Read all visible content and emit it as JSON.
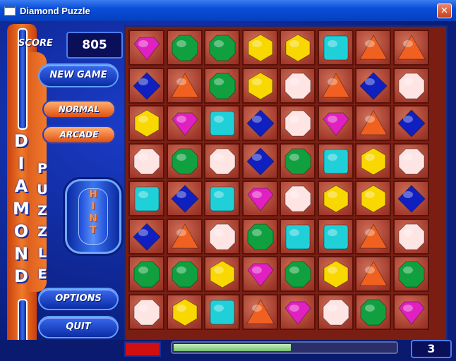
{
  "window": {
    "title": "Diamond Puzzle",
    "close_glyph": "✕"
  },
  "side": {
    "score_label": "SCORE",
    "score_value": "805",
    "new_game_label": "NEW GAME",
    "normal_label": "NORMAL",
    "arcade_label": "ARCADE",
    "hint_letters": [
      "H",
      "I",
      "N",
      "T"
    ],
    "options_label": "OPTIONS",
    "quit_label": "QUIT",
    "title_word1": [
      "D",
      "I",
      "A",
      "M",
      "O",
      "N",
      "D"
    ],
    "title_word2": [
      "P",
      "U",
      "Z",
      "Z",
      "L",
      "E"
    ]
  },
  "status": {
    "level": "3",
    "progress": 0.53,
    "indicator_color": "#d01010"
  },
  "colors": {
    "magenta": "#e020c0",
    "green": "#10a040",
    "yellow": "#f8d800",
    "cyan": "#20d0d8",
    "orange": "#f06020",
    "blue": "#1020c0",
    "white": "#ffe4e4"
  },
  "board": [
    [
      "magenta-gem",
      "green-gem",
      "green-gem",
      "yellow-gem",
      "yellow-gem",
      "cyan-gem",
      "orange-gem",
      "orange-gem"
    ],
    [
      "blue-gem",
      "orange-gem",
      "green-gem",
      "yellow-gem",
      "white-gem",
      "orange-gem",
      "blue-gem",
      "white-gem"
    ],
    [
      "yellow-gem",
      "magenta-gem",
      "cyan-gem",
      "blue-gem",
      "white-gem",
      "magenta-gem",
      "orange-gem",
      "blue-gem"
    ],
    [
      "white-gem",
      "green-gem",
      "white-gem",
      "blue-gem",
      "green-gem",
      "cyan-gem",
      "yellow-gem",
      "white-gem"
    ],
    [
      "cyan-gem",
      "blue-gem",
      "cyan-gem",
      "magenta-gem",
      "white-gem",
      "yellow-gem",
      "yellow-gem",
      "blue-gem"
    ],
    [
      "blue-gem",
      "orange-gem",
      "white-gem",
      "green-gem",
      "cyan-gem",
      "cyan-gem",
      "orange-gem",
      "white-gem"
    ],
    [
      "green-gem",
      "green-gem",
      "yellow-gem",
      "magenta-gem",
      "green-gem",
      "yellow-gem",
      "orange-gem",
      "green-gem"
    ],
    [
      "white-gem",
      "yellow-gem",
      "cyan-gem",
      "orange-gem",
      "magenta-gem",
      "white-gem",
      "green-gem",
      "magenta-gem"
    ]
  ]
}
